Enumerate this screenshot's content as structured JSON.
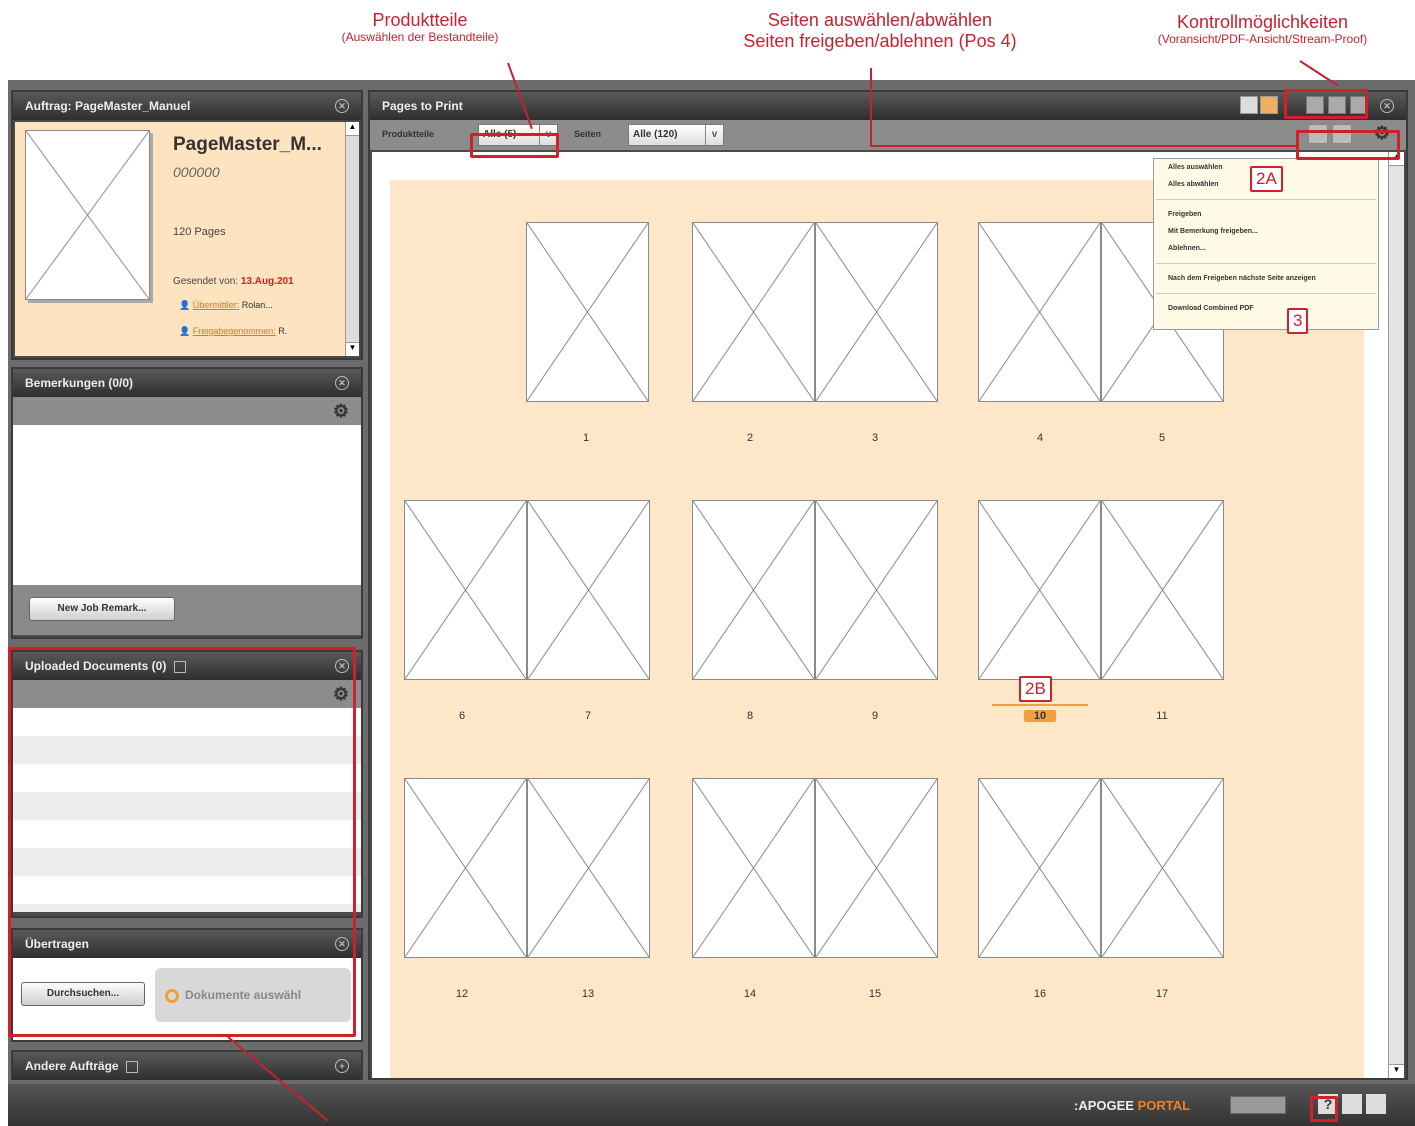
{
  "annotations": {
    "produktteile_title": "Produktteile",
    "produktteile_sub": "(Auswählen der Bestandteile)",
    "seiten_line1": "Seiten auswählen/abwählen",
    "seiten_line2": "Seiten freigeben/ablehnen (Pos 4)",
    "kontroll_title": "Kontrollmöglichkeiten",
    "kontroll_sub": "(Voransicht/PDF-Ansicht/Stream-Proof)",
    "tag_2a": "2A",
    "tag_2b": "2B",
    "tag_3": "3"
  },
  "job_panel": {
    "title": "Auftrag: PageMaster_Manuel",
    "job_name": "PageMaster_M...",
    "job_number": "000000",
    "pages": "120 Pages",
    "sent_label": "Gesendet von:",
    "sent_date": "13.Aug.201",
    "user1": "Übermittler:",
    "user1_value": "Rolan...",
    "user2": "Freigabegenommen:",
    "user2_value": "R."
  },
  "remarks_panel": {
    "title": "Bemerkungen (0/0)",
    "new_button": "New Job Remark..."
  },
  "uploaded_panel": {
    "title": "Uploaded Documents (0)"
  },
  "transfer_panel": {
    "title": "Übertragen",
    "browse_button": "Durchsuchen...",
    "select_docs": "Dokumente auswähl"
  },
  "other_panel": {
    "title": "Andere Aufträge"
  },
  "main": {
    "title": "Pages to Print",
    "produktteile_label": "Produktteile",
    "produktteile_value": "Alle (5)",
    "seiten_label": "Seiten",
    "seiten_value": "Alle (120)"
  },
  "menu": {
    "items": [
      "Alles auswählen",
      "Alles abwählen",
      "Freigeben",
      "Mit Bemerkung freigeben...",
      "Ablehnen...",
      "Nach dem Freigeben nächste Seite anzeigen",
      "Download Combined PDF"
    ]
  },
  "pages": {
    "row1": [
      "1",
      "2",
      "3",
      "4",
      "5"
    ],
    "row2": [
      "6",
      "7",
      "8",
      "9",
      "10",
      "11"
    ],
    "row3": [
      "12",
      "13",
      "14",
      "15",
      "16",
      "17"
    ]
  },
  "footer": {
    "brand_a": ":APOGEE",
    "brand_b": " PORTAL",
    "help": "?"
  },
  "colors": {
    "accent_red": "#c8202f",
    "page_bg": "#fde7c8",
    "highlight": "#f0a040"
  }
}
